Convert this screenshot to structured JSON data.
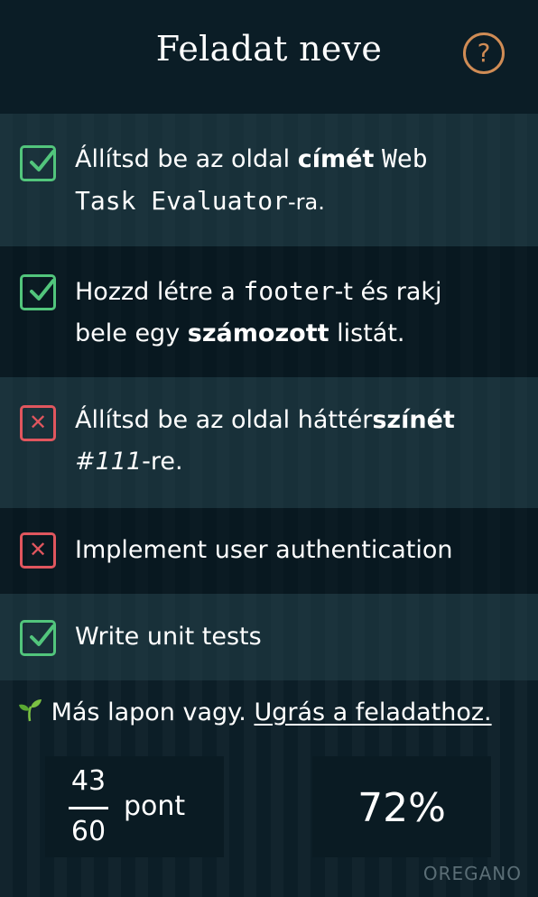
{
  "header": {
    "title": "Feladat neve",
    "help_symbol": "?"
  },
  "tasks": [
    {
      "status": "done",
      "parts": [
        "Állítsd be az oldal ",
        "címét",
        " ",
        "Web Task Evaluator",
        "-ra."
      ]
    },
    {
      "status": "done",
      "parts": [
        "Hozzd létre a ",
        "footer",
        "-t és rakj bele egy ",
        "számozott",
        " listát."
      ]
    },
    {
      "status": "failed",
      "parts": [
        "Állítsd be az oldal háttér",
        "színét",
        " ",
        "#111",
        "-re."
      ]
    },
    {
      "status": "failed",
      "parts": [
        "Implement user authentication"
      ]
    },
    {
      "status": "done",
      "parts": [
        "Write unit tests"
      ]
    }
  ],
  "notice": {
    "text": "Más lapon vagy.",
    "link": "Ugrás a feladathoz.",
    "icon": "sprout-icon"
  },
  "score": {
    "earned": "43",
    "total": "60",
    "unit": "pont"
  },
  "percent": "72%",
  "brand": "OREGANO",
  "colors": {
    "done": "#52c57c",
    "failed": "#e0565e",
    "help": "#d08c55"
  }
}
